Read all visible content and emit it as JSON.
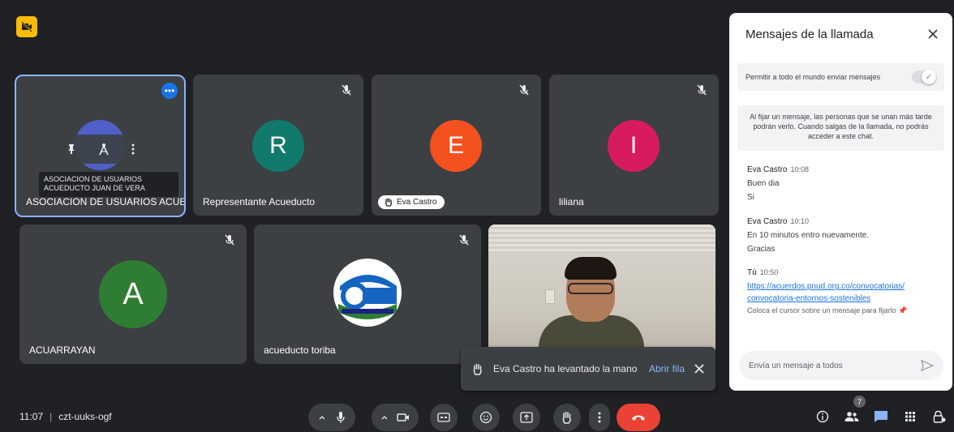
{
  "meeting": {
    "time": "11:07",
    "separator": "|",
    "code": "czt-uuks-ogf",
    "participant_count": "7"
  },
  "tiles": [
    {
      "name": "ASOCIACION DE USUARIOS ACUE...",
      "tooltip": "ASOCIACION DE USUARIOS ACUEDUCTO JUAN DE VERA",
      "more": "•••"
    },
    {
      "name": "Representante Acueducto",
      "initial": "R",
      "color": "#12796d"
    },
    {
      "chip": "Eva Castro",
      "initial": "E",
      "color": "#f4511e"
    },
    {
      "name": "liliana",
      "initial": "I",
      "color": "#d81b60"
    },
    {
      "name": "ACUARRAYAN",
      "initial": "A",
      "color": "#2e7d32"
    },
    {
      "name": "acueducto toriba"
    }
  ],
  "toast": {
    "message": "Eva Castro ha levantado la mano",
    "action": "Abrir fila"
  },
  "panel": {
    "title": "Mensajes de la llamada",
    "permission_label": "Permitir a todo el mundo enviar mensajes",
    "info": "Al fijar un mensaje, las personas que se unan más tarde podrán verlo. Cuando salgas de la llamada, no podrás acceder a este chat.",
    "messages": [
      {
        "sender": "Eva Castro",
        "time": "10:08",
        "lines": [
          "Buen dia",
          "Si"
        ]
      },
      {
        "sender": "Eva Castro",
        "time": "10:10",
        "lines": [
          "En 10 minutos entro nuevamente.",
          "Gracias"
        ]
      },
      {
        "sender": "Tú",
        "time": "10:50",
        "link_1": "https://acuerdos.pnud.org.co/convocatorias/",
        "link_2": "convocatoria-entornos-sostenibles",
        "hint": "Coloca el cursor sobre un mensaje para fijarlo"
      }
    ],
    "composer_placeholder": "Envía un mensaje a todos"
  },
  "colors": {
    "background": "#202124",
    "tile": "#3c4043",
    "accent_blue": "#8ab4f8",
    "end_call": "#ea4335"
  }
}
